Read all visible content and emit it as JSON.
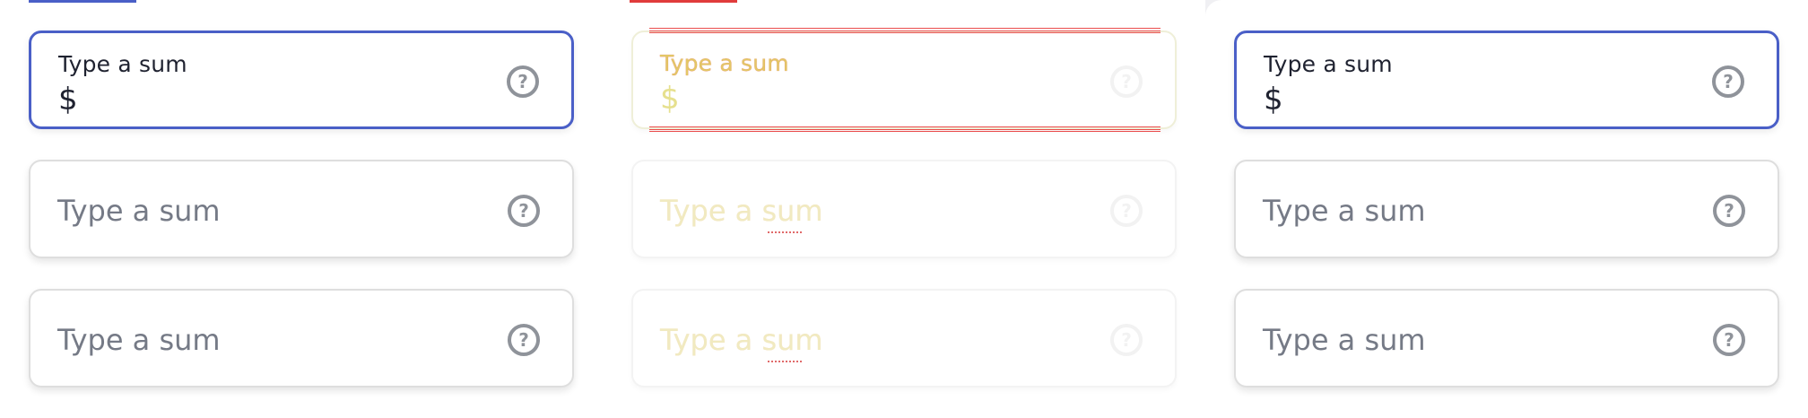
{
  "colors": {
    "accent": "#4a5fc7",
    "debug_red": "#e03b3b",
    "placeholder_text": "#757a86",
    "icon_gray": "#8f939a"
  },
  "panels": [
    {
      "fields": [
        {
          "label": "Type a sum",
          "value": "$",
          "state": "focused",
          "icon": "question-circle-icon"
        },
        {
          "placeholder": "Type a sum",
          "state": "idle",
          "icon": "question-circle-icon"
        },
        {
          "placeholder": "Type a sum",
          "state": "idle",
          "icon": "question-circle-icon"
        }
      ]
    },
    {
      "fields": [
        {
          "label": "Type a sum",
          "value": "$",
          "state": "focused",
          "icon": "question-circle-icon"
        },
        {
          "placeholder": "Type a sum",
          "state": "idle",
          "icon": "question-circle-icon"
        },
        {
          "placeholder": "Type a sum",
          "state": "idle",
          "icon": "question-circle-icon"
        }
      ]
    },
    {
      "fields": [
        {
          "label": "Type a sum",
          "value": "$",
          "state": "focused",
          "icon": "question-circle-icon"
        },
        {
          "placeholder": "Type a sum",
          "state": "idle",
          "icon": "question-circle-icon"
        },
        {
          "placeholder": "Type a sum",
          "state": "idle",
          "icon": "question-circle-icon"
        }
      ]
    }
  ]
}
